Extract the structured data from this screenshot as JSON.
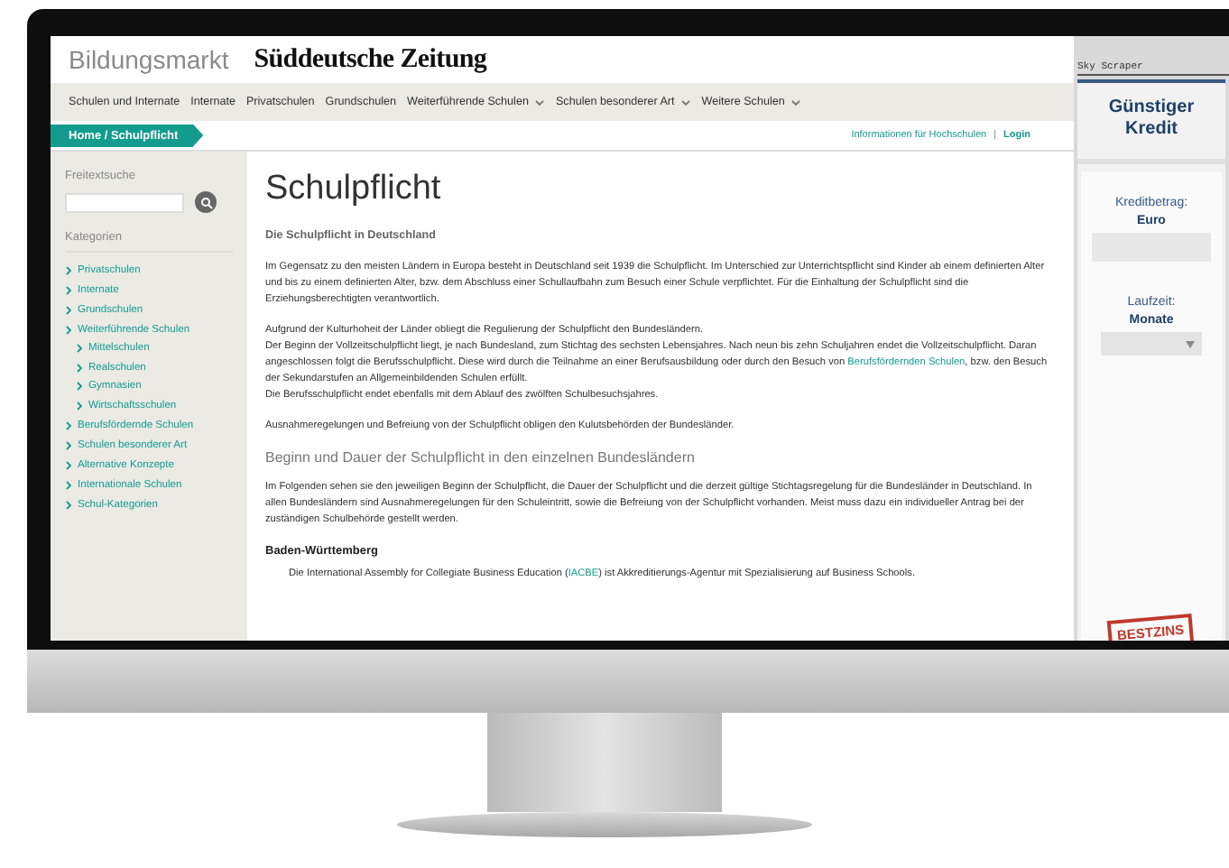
{
  "header": {
    "brand": "Bildungsmarkt",
    "logo": "Süddeutsche Zeitung"
  },
  "nav": [
    {
      "label": "Schulen und Internate",
      "dropdown": false
    },
    {
      "label": "Internate",
      "dropdown": false
    },
    {
      "label": "Privatschulen",
      "dropdown": false
    },
    {
      "label": "Grundschulen",
      "dropdown": false
    },
    {
      "label": "Weiterführende Schulen",
      "dropdown": true
    },
    {
      "label": "Schulen besonderer Art",
      "dropdown": true
    },
    {
      "label": "Weitere Schulen",
      "dropdown": true
    }
  ],
  "breadcrumb": "Home / Schulpflicht",
  "top_links": {
    "items": [
      "Informationen für Hochschulen",
      "Login"
    ],
    "separator": "|"
  },
  "sidebar": {
    "search_label": "Freitextsuche",
    "categories_label": "Kategorien",
    "categories": [
      {
        "label": "Privatschulen"
      },
      {
        "label": "Internate"
      },
      {
        "label": "Grundschulen"
      },
      {
        "label": "Weiterführende Schulen",
        "children": [
          {
            "label": "Mittelschulen"
          },
          {
            "label": "Realschulen"
          },
          {
            "label": "Gymnasien"
          },
          {
            "label": "Wirtschaftsschulen"
          }
        ]
      },
      {
        "label": "Berufsfördernde Schulen"
      },
      {
        "label": "Schulen besonderer Art"
      },
      {
        "label": "Alternative Konzepte"
      },
      {
        "label": "Internationale Schulen"
      },
      {
        "label": "Schul-Kategorien"
      }
    ]
  },
  "article": {
    "title": "Schulpflicht",
    "blocks": [
      {
        "kind": "subheading",
        "parts": [
          {
            "text": "Die Schulpflicht in Deutschland"
          }
        ]
      },
      {
        "kind": "paragraph",
        "parts": [
          {
            "text": "Im Gegensatz zu den meisten Ländern in Europa besteht in Deutschland seit 1939 die Schulpflicht. Im Unterschied zur Unterrichtspflicht sind Kinder ab einem definierten Alter und bis zu einem definierten Alter, bzw. dem Abschluss einer Schullaufbahn zum Besuch einer Schule verpflichtet. Für die Einhaltung der Schulpflicht sind die Erziehungsberechtigten verantwortlich."
          }
        ]
      },
      {
        "kind": "line",
        "parts": [
          {
            "text": "Aufgrund der Kulturhoheit der Länder obliegt die Regulierung der Schulpflicht den Bundesländern."
          }
        ]
      },
      {
        "kind": "line",
        "parts": [
          {
            "text": "Der Beginn der Vollzeitschulpflicht liegt, je nach Bundesland, zum Stichtag des sechsten Lebensjahres. Nach neun bis zehn Schuljahren endet die Vollzeitschulpflicht. Daran angeschlossen folgt die Berufsschulpflicht. Diese wird durch die Teilnahme an einer Berufsausbildung oder durch den Besuch von "
          },
          {
            "text": "Berufsfördernden Schulen",
            "link": true
          },
          {
            "text": ", bzw. den Besuch der Sekundarstufen an Allgemeinbildenden Schulen erfüllt."
          }
        ]
      },
      {
        "kind": "paragraph",
        "parts": [
          {
            "text": "Die Berufsschulpflicht endet ebenfalls mit dem Ablauf des zwölften Schulbesuchsjahres."
          }
        ]
      },
      {
        "kind": "paragraph",
        "parts": [
          {
            "text": "Ausnahmeregelungen und Befreiung von der Schulpflicht obligen den Kulutsbehörden der Bundesländer."
          }
        ]
      },
      {
        "kind": "heading",
        "parts": [
          {
            "text": "Beginn und Dauer der Schulpflicht in den einzelnen Bundesländern"
          }
        ]
      },
      {
        "kind": "paragraph",
        "parts": [
          {
            "text": "Im Folgenden sehen sie den jeweiligen Beginn der Schulpflicht, die Dauer der Schulpflicht und die derzeit gültige Stichtagsregelung für die Bundesländer in Deutschland. In allen Bundesländern sind Ausnahmeregelungen für den Schuleintritt, sowie die Befreiung von der Schulpflicht vorhanden. Meist muss dazu ein individueller Antrag bei der zuständigen Schulbehörde gestellt werden."
          }
        ]
      },
      {
        "kind": "state",
        "parts": [
          {
            "text": "Baden-Württemberg"
          }
        ]
      },
      {
        "kind": "indented",
        "parts": [
          {
            "text": "Die International Assembly for Collegiate Business Education ("
          },
          {
            "text": "IACBE",
            "link": true
          },
          {
            "text": ") ist Akkreditierungs-Agentur mit Spezialisierung auf Business Schools."
          }
        ]
      }
    ]
  },
  "ad": {
    "label": "Sky Scraper",
    "title": "Günstiger Kredit",
    "fields": [
      {
        "kind": "input",
        "label": "Kreditbetrag:",
        "unit": "Euro"
      },
      {
        "kind": "select",
        "label": "Laufzeit:",
        "unit": "Monate"
      }
    ],
    "stamp": "BESTZINS"
  }
}
